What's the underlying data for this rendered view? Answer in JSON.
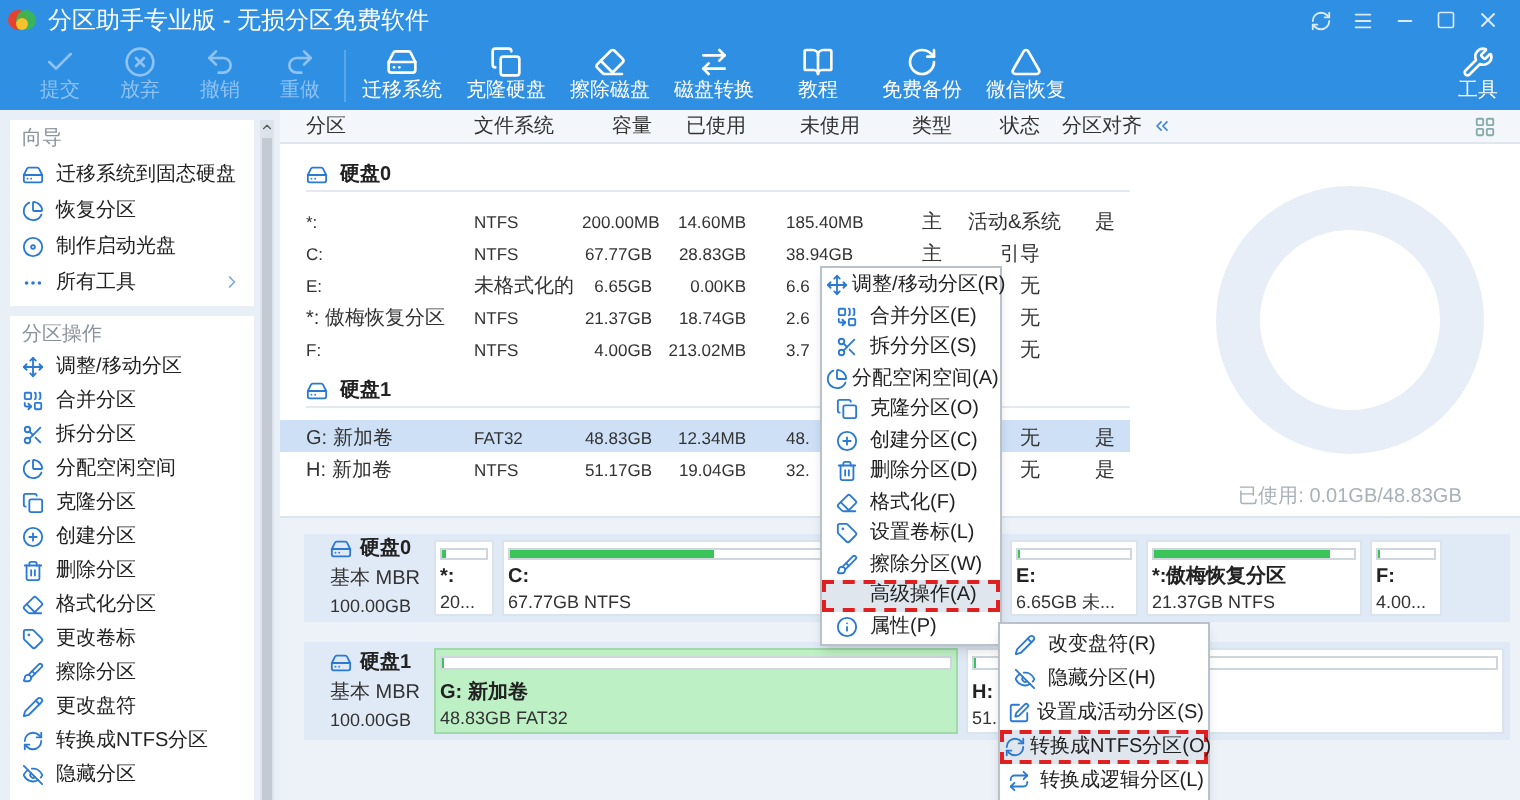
{
  "window": {
    "title": "分区助手专业版 - 无损分区免费软件"
  },
  "toolbar": [
    {
      "label": "提交",
      "disabled": true
    },
    {
      "label": "放弃",
      "disabled": true
    },
    {
      "label": "撤销",
      "disabled": true
    },
    {
      "label": "重做",
      "disabled": true
    },
    {
      "label": "迁移系统",
      "disabled": false
    },
    {
      "label": "克隆硬盘",
      "disabled": false
    },
    {
      "label": "擦除磁盘",
      "disabled": false
    },
    {
      "label": "磁盘转换",
      "disabled": false
    },
    {
      "label": "教程",
      "disabled": false
    },
    {
      "label": "免费备份",
      "disabled": false
    },
    {
      "label": "微信恢复",
      "disabled": false
    }
  ],
  "tools_button": {
    "label": "工具"
  },
  "sidebar": {
    "sections": [
      {
        "title": "向导",
        "items": [
          {
            "label": "迁移系统到固态硬盘",
            "kind": "action"
          },
          {
            "label": "恢复分区",
            "kind": "action"
          },
          {
            "label": "制作启动光盘",
            "kind": "action"
          },
          {
            "label": "所有工具",
            "kind": "more"
          }
        ]
      },
      {
        "title": "分区操作",
        "items": [
          {
            "label": "调整/移动分区",
            "kind": "action"
          },
          {
            "label": "合并分区",
            "kind": "action"
          },
          {
            "label": "拆分分区",
            "kind": "action"
          },
          {
            "label": "分配空闲空间",
            "kind": "action"
          },
          {
            "label": "克隆分区",
            "kind": "action"
          },
          {
            "label": "创建分区",
            "kind": "action"
          },
          {
            "label": "删除分区",
            "kind": "action"
          },
          {
            "label": "格式化分区",
            "kind": "action"
          },
          {
            "label": "更改卷标",
            "kind": "action"
          },
          {
            "label": "擦除分区",
            "kind": "action"
          },
          {
            "label": "更改盘符",
            "kind": "action"
          },
          {
            "label": "转换成NTFS分区",
            "kind": "action"
          },
          {
            "label": "隐藏分区",
            "kind": "action"
          }
        ]
      }
    ]
  },
  "table": {
    "columns": [
      "分区",
      "文件系统",
      "容量",
      "已使用",
      "未使用",
      "类型",
      "状态",
      "分区对齐"
    ],
    "groups": [
      {
        "disk": "硬盘0",
        "rows": [
          {
            "cells": [
              "*:",
              "NTFS",
              "200.00MB",
              "14.60MB",
              "185.40MB",
              "主",
              "活动&系统",
              "是"
            ],
            "selected": false
          },
          {
            "cells": [
              "C:",
              "NTFS",
              "67.77GB",
              "28.83GB",
              "38.94GB",
              "主",
              "引导",
              null
            ],
            "selected": false
          },
          {
            "cells": [
              "E:",
              "未格式化的",
              "6.65GB",
              "0.00KB",
              "6.6",
              null,
              "无",
              null
            ],
            "selected": false
          },
          {
            "cells": [
              "*: 傲梅恢复分区",
              "NTFS",
              "21.37GB",
              "18.74GB",
              "2.6",
              null,
              "无",
              null
            ],
            "selected": false
          },
          {
            "cells": [
              "F:",
              "NTFS",
              "4.00GB",
              "213.02MB",
              "3.7",
              null,
              "无",
              null
            ],
            "selected": false
          }
        ]
      },
      {
        "disk": "硬盘1",
        "rows": [
          {
            "cells": [
              "G: 新加卷",
              "FAT32",
              "48.83GB",
              "12.34MB",
              "48.",
              null,
              "无",
              "是"
            ],
            "selected": true
          },
          {
            "cells": [
              "H: 新加卷",
              "NTFS",
              "51.17GB",
              "19.04GB",
              "32.",
              null,
              "无",
              "是"
            ],
            "selected": false
          }
        ]
      }
    ]
  },
  "usage_caption": "已使用: 0.01GB/48.83GB",
  "disk_map": [
    {
      "name": "硬盘0",
      "type": "基本 MBR",
      "size": "100.00GB",
      "partitions": [
        {
          "label": "*:",
          "detail": "20...",
          "level": 0.07,
          "selected": false
        },
        {
          "label": "C:",
          "detail": "67.77GB NTFS",
          "level": 0.42,
          "selected": false
        },
        {
          "label": "E:",
          "detail": "6.65GB 未...",
          "level": 0,
          "selected": false
        },
        {
          "label": "*:傲梅恢复分区",
          "detail": "21.37GB NTFS",
          "level": 0.88,
          "selected": false
        },
        {
          "label": "F:",
          "detail": "4.00...",
          "level": 0.05,
          "selected": false
        }
      ]
    },
    {
      "name": "硬盘1",
      "type": "基本 MBR",
      "size": "100.00GB",
      "partitions": [
        {
          "label": "G: 新加卷",
          "detail": "48.83GB FAT32",
          "level": 0,
          "selected": true
        },
        {
          "label": "H:",
          "detail": "51.",
          "level": 0,
          "selected": false
        }
      ]
    }
  ],
  "context_menu": {
    "items": [
      {
        "label": "调整/移动分区(R)",
        "highlighted": false
      },
      {
        "label": "合并分区(E)",
        "highlighted": false
      },
      {
        "label": "拆分分区(S)",
        "highlighted": false
      },
      {
        "label": "分配空闲空间(A)",
        "highlighted": false
      },
      {
        "label": "克隆分区(O)",
        "highlighted": false
      },
      {
        "label": "创建分区(C)",
        "highlighted": false
      },
      {
        "label": "删除分区(D)",
        "highlighted": false
      },
      {
        "label": "格式化(F)",
        "highlighted": false
      },
      {
        "label": "设置卷标(L)",
        "highlighted": false
      },
      {
        "label": "擦除分区(W)",
        "highlighted": false
      },
      {
        "label": "高级操作(A)",
        "highlighted": true
      },
      {
        "label": "属性(P)",
        "highlighted": false
      }
    ]
  },
  "submenu": {
    "items": [
      {
        "label": "改变盘符(R)",
        "highlighted": false
      },
      {
        "label": "隐藏分区(H)",
        "highlighted": false
      },
      {
        "label": "设置成活动分区(S)",
        "highlighted": false
      },
      {
        "label": "转换成NTFS分区(O)",
        "highlighted": true
      },
      {
        "label": "转换成逻辑分区(L)",
        "highlighted": false
      }
    ]
  }
}
